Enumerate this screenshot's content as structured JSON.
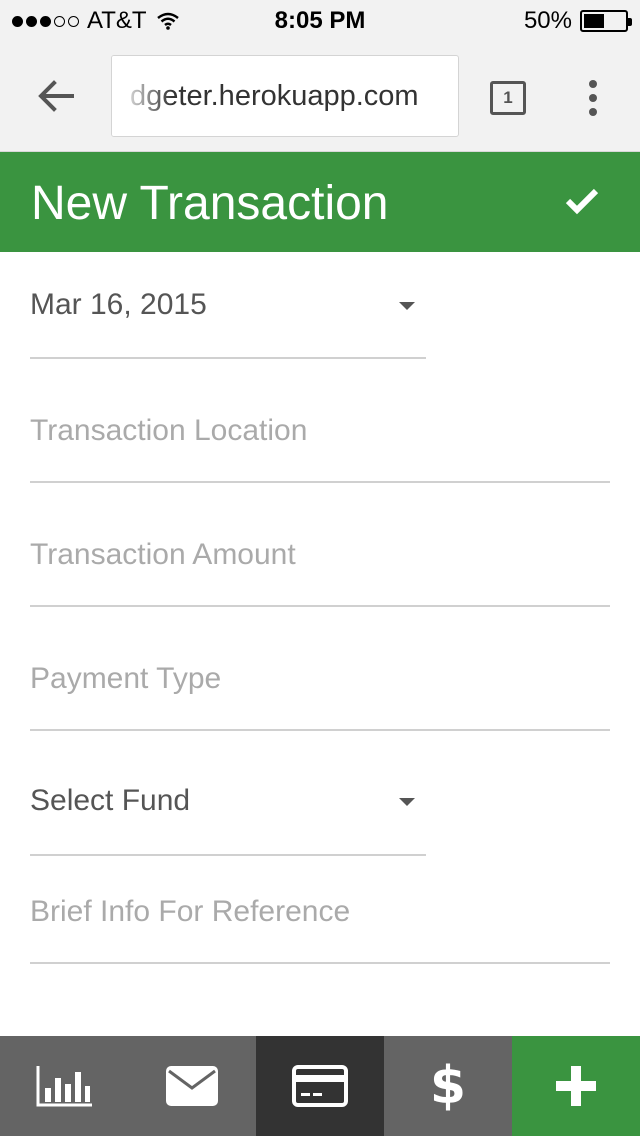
{
  "status_bar": {
    "carrier": "AT&T",
    "time": "8:05 PM",
    "battery_percent_label": "50%",
    "battery_level": 0.5,
    "signal_bars": 3,
    "signal_total": 5
  },
  "browser": {
    "url": "dgeter.herokuapp.com",
    "tab_count": "1",
    "back_icon": "arrow-left-icon",
    "menu_icon": "overflow-menu-icon"
  },
  "header": {
    "title": "New Transaction",
    "confirm_icon": "checkmark-icon",
    "color": "#3a9440"
  },
  "form": {
    "date_value": "Mar 16, 2015",
    "location_placeholder": "Transaction Location",
    "amount_placeholder": "Transaction Amount",
    "payment_type_placeholder": "Payment Type",
    "fund_value": "Select Fund",
    "reference_placeholder": "Brief Info For Reference"
  },
  "bottom_nav": {
    "items": [
      {
        "icon": "bar-chart-icon",
        "active": false
      },
      {
        "icon": "envelope-icon",
        "active": false
      },
      {
        "icon": "credit-card-icon",
        "active": true
      },
      {
        "icon": "dollar-icon",
        "label": "$",
        "active": false
      },
      {
        "icon": "plus-icon",
        "active": false
      }
    ]
  },
  "colors": {
    "accent": "#3a9440",
    "nav_default": "#646464",
    "nav_active": "#333333"
  }
}
